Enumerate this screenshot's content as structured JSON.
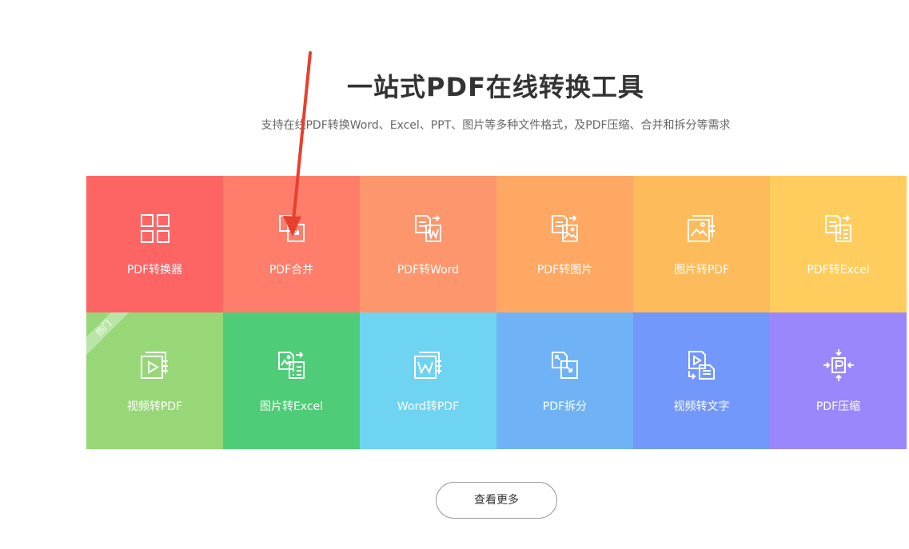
{
  "header": {
    "title": "一站式PDF在线转换工具",
    "subtitle": "支持在线PDF转换Word、Excel、PPT、图片等多种文件格式，及PDF压缩、合并和拆分等需求"
  },
  "tools": [
    {
      "label": "PDF转换器",
      "icon": "grid-icon",
      "color": "#fd6565"
    },
    {
      "label": "PDF合并",
      "icon": "pdf-merge-icon",
      "color": "#fe7e6b"
    },
    {
      "label": "PDF转Word",
      "icon": "pdf-to-word-icon",
      "color": "#fe966d"
    },
    {
      "label": "PDF转图片",
      "icon": "pdf-to-image-icon",
      "color": "#fea863"
    },
    {
      "label": "图片转PDF",
      "icon": "image-to-pdf-icon",
      "color": "#febb5b"
    },
    {
      "label": "PDF转Excel",
      "icon": "pdf-to-excel-icon",
      "color": "#fecd5e"
    },
    {
      "label": "视频转PDF",
      "icon": "video-to-pdf-icon",
      "color": "#97d778",
      "badge": "热门"
    },
    {
      "label": "图片转Excel",
      "icon": "image-to-excel-icon",
      "color": "#4fcc77"
    },
    {
      "label": "Word转PDF",
      "icon": "word-to-pdf-icon",
      "color": "#6fd3f2"
    },
    {
      "label": "PDF拆分",
      "icon": "pdf-split-icon",
      "color": "#6fb3f6"
    },
    {
      "label": "视频转文字",
      "icon": "video-to-text-icon",
      "color": "#7398fc"
    },
    {
      "label": "PDF压缩",
      "icon": "pdf-compress-icon",
      "color": "#9b87fc"
    }
  ],
  "more_button": {
    "label": "查看更多"
  },
  "annotation": {
    "arrow_color": "#e8402f"
  }
}
